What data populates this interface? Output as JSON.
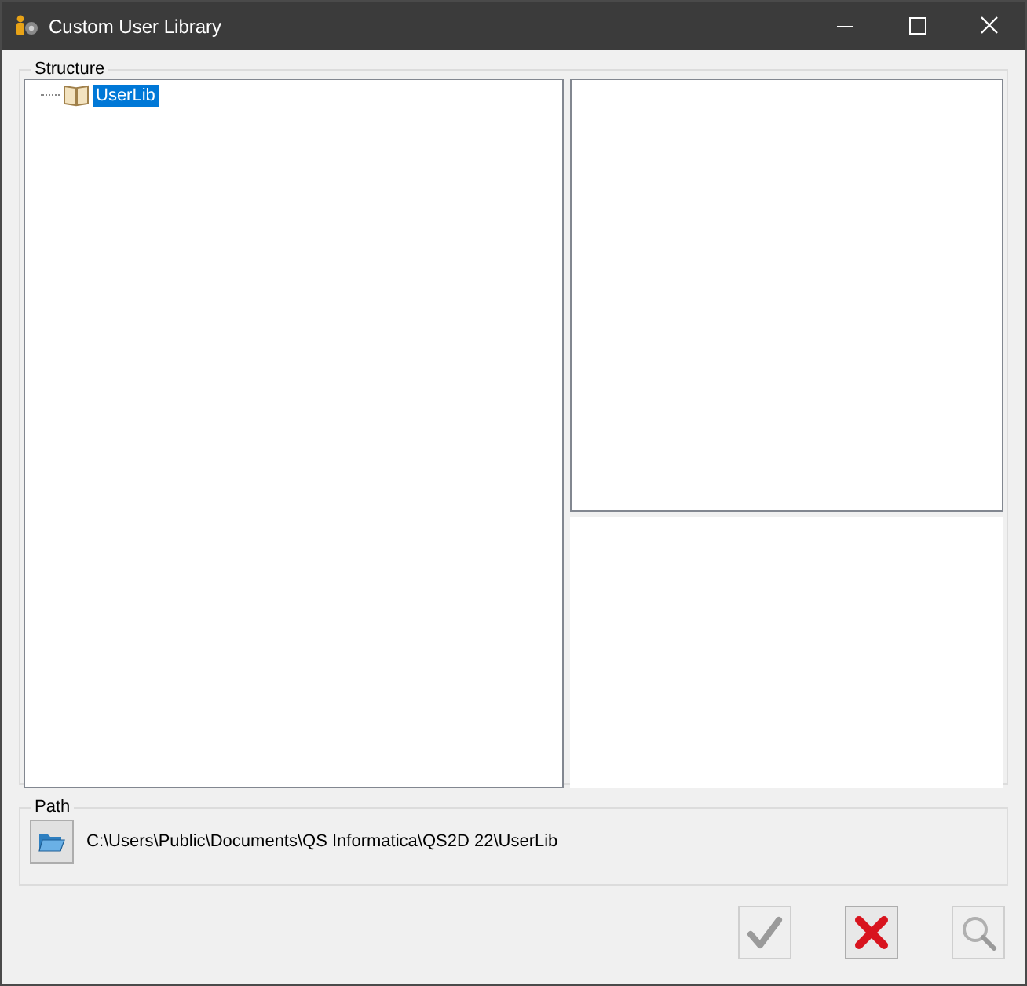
{
  "window": {
    "title": "Custom User Library"
  },
  "structure": {
    "label": "Structure",
    "tree": [
      {
        "label": "UserLib",
        "selected": true
      }
    ]
  },
  "path": {
    "label": "Path",
    "value": "C:\\Users\\Public\\Documents\\QS Informatica\\QS2D 22\\UserLib"
  },
  "buttons": [
    {
      "kind": "ok",
      "disabled": true
    },
    {
      "kind": "cancel",
      "disabled": false
    },
    {
      "kind": "preview",
      "disabled": true
    }
  ]
}
